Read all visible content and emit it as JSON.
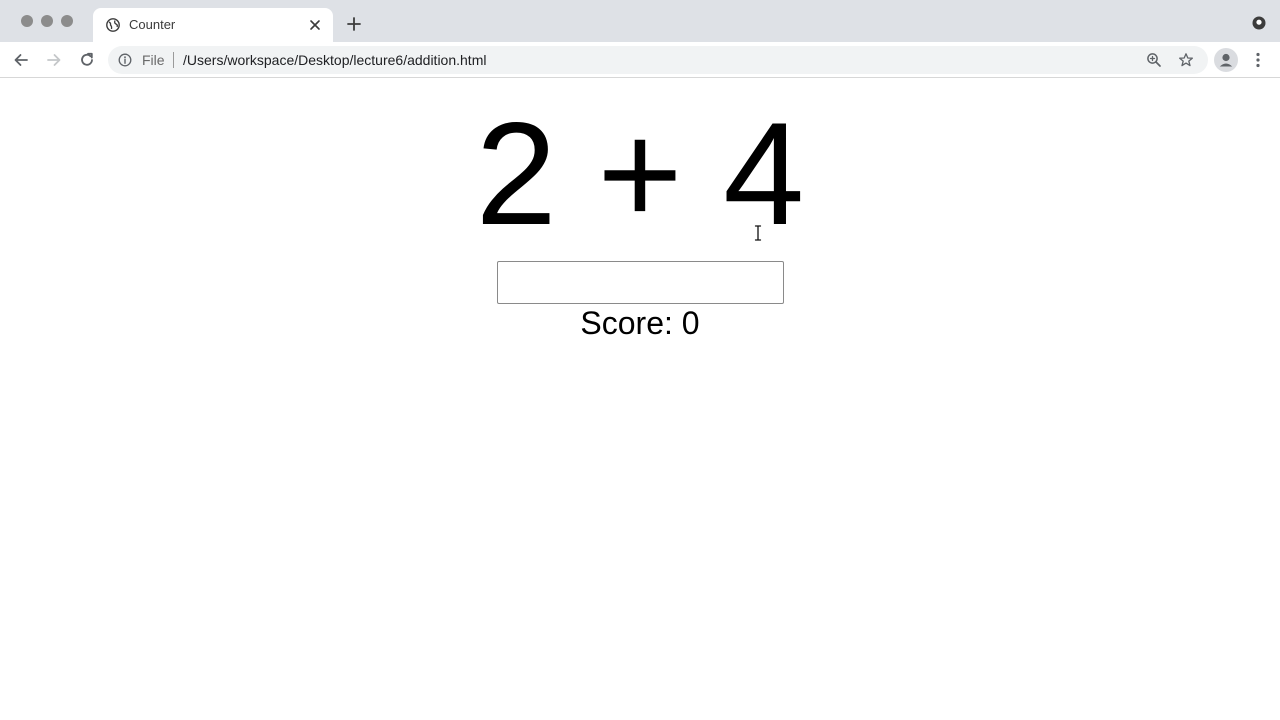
{
  "browser": {
    "tab_title": "Counter",
    "scheme_label": "File",
    "url": "/Users/workspace/Desktop/lecture6/addition.html",
    "icons": {
      "traffic_lights": "window-control-dots",
      "favicon": "globe-icon",
      "close": "close-icon",
      "new_tab": "plus-icon",
      "back": "arrow-left-icon",
      "forward": "arrow-right-icon",
      "reload": "reload-icon",
      "info": "info-icon",
      "zoom": "zoom-icon",
      "bookmark": "star-icon",
      "account": "account-icon",
      "menu": "more-vertical-icon",
      "extension": "profile-chip-icon"
    }
  },
  "page": {
    "problem": "2 + 4",
    "answer_input": {
      "value": "",
      "placeholder": ""
    },
    "score": "Score: 0"
  }
}
